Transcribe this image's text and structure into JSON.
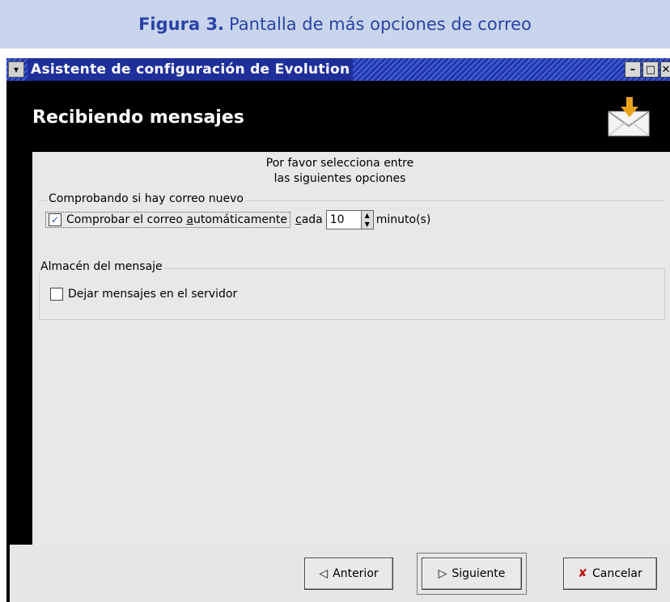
{
  "caption": {
    "figure": "Figura 3.",
    "text": "Pantalla de más opciones de correo"
  },
  "window": {
    "title": "Asistente de configuración de Evolution",
    "header_title": "Recibiendo mensajes",
    "controls": {
      "minimize": "–",
      "maximize": "□",
      "close": "✕"
    }
  },
  "intro": {
    "line1": "Por favor selecciona entre",
    "line2": "las siguientes opciones"
  },
  "check_group": {
    "label": "Comprobando si hay correo nuevo",
    "auto_check": {
      "label_pre": "Comprobar el correo ",
      "label_u": "a",
      "label_post": "utomáticamente",
      "checked": true
    },
    "cada_u": "c",
    "cada_rest": "ada",
    "interval": "10",
    "unit": "minuto(s)"
  },
  "store_group": {
    "label": "Almacén del mensaje",
    "leave_on_server": {
      "label": "Dejar mensajes en el servidor",
      "checked": false
    }
  },
  "buttons": {
    "back": "Anterior",
    "next": "Siguiente",
    "cancel": "Cancelar"
  },
  "colors": {
    "accent": "#2a43a6",
    "titlebar": "#1e2f9a",
    "caption_bg": "#c9d5ec"
  }
}
